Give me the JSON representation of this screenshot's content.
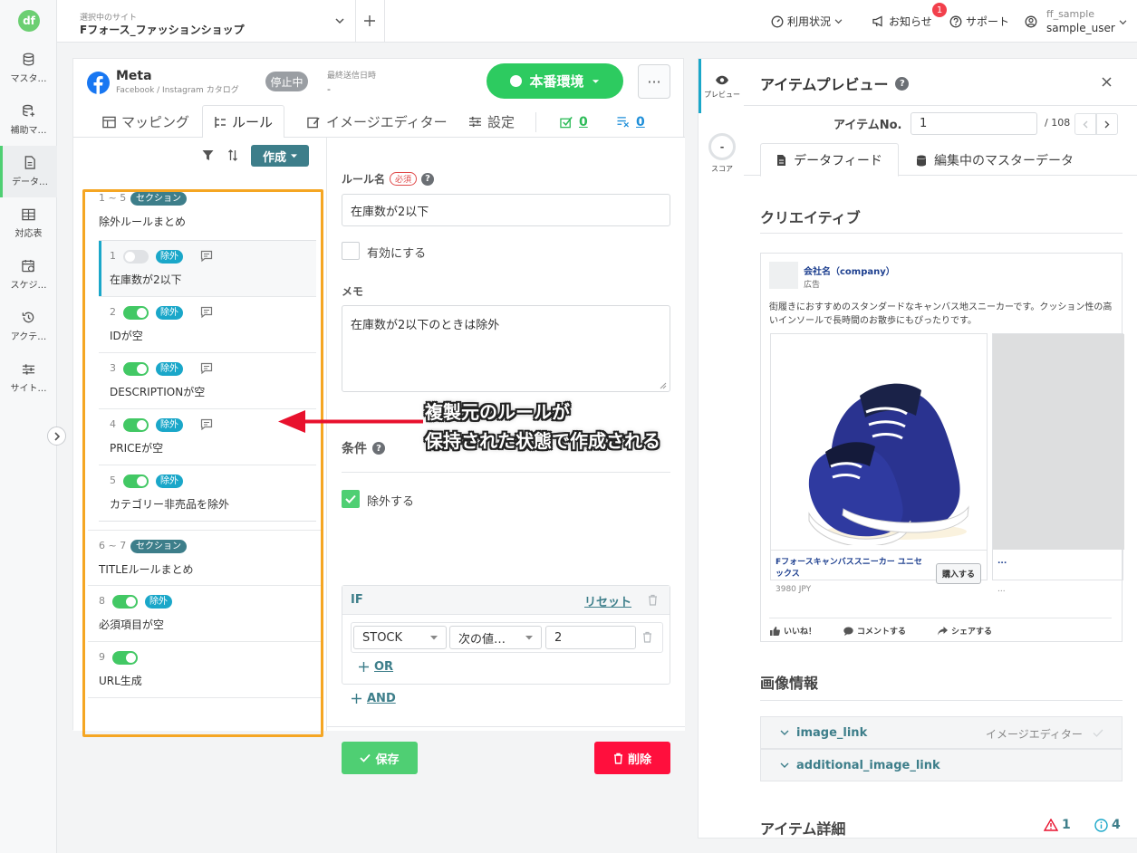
{
  "nav": {
    "items": [
      {
        "label": "マスタ…",
        "icon": "database-icon"
      },
      {
        "label": "補助マ…",
        "icon": "database-plus-icon"
      },
      {
        "label": "データ…",
        "icon": "document-icon"
      },
      {
        "label": "対応表",
        "icon": "table-icon"
      },
      {
        "label": "スケジ…",
        "icon": "schedule-icon"
      },
      {
        "label": "アクテ…",
        "icon": "history-icon"
      },
      {
        "label": "サイト…",
        "icon": "sliders-icon"
      }
    ]
  },
  "topbar": {
    "site_sub": "選択中のサイト",
    "site_name": "Fフォース_ファッションショップ",
    "usage": "利用状況",
    "news": "お知らせ",
    "news_count": "1",
    "support": "サポート",
    "user_id": "ff_sample",
    "user_name": "sample_user"
  },
  "channel": {
    "name": "Meta",
    "sub": "Facebook / Instagram カタログ",
    "status": "停止中",
    "last_sent_label": "最終送信日時",
    "last_sent_value": "-",
    "env_label": "本番環境",
    "more": "···"
  },
  "tabs": {
    "mapping": "マッピング",
    "rules": "ルール",
    "image_editor": "イメージエディター",
    "settings": "設定",
    "count_ok": "0",
    "count_ng": "0"
  },
  "list": {
    "create": "作成",
    "section1": {
      "range": "1 ~ 5",
      "tag": "セクション",
      "name": "除外ルールまとめ"
    },
    "rules_g1": [
      {
        "num": "1",
        "tag": "除外",
        "name": "在庫数が2以下"
      },
      {
        "num": "2",
        "tag": "除外",
        "name": "IDが空"
      },
      {
        "num": "3",
        "tag": "除外",
        "name": "DESCRIPTIONが空"
      },
      {
        "num": "4",
        "tag": "除外",
        "name": "PRICEが空"
      },
      {
        "num": "5",
        "tag": "除外",
        "name": "カテゴリー非売品を除外"
      }
    ],
    "section2": {
      "range": "6 ~ 7",
      "tag": "セクション",
      "name": "TITLEルールまとめ"
    },
    "rule8": {
      "num": "8",
      "tag": "除外",
      "name": "必須項目が空"
    },
    "rule9": {
      "num": "9",
      "name": "URL生成"
    }
  },
  "form": {
    "rule_name_label": "ルール名",
    "required": "必須",
    "rule_name_value": "在庫数が2以下",
    "enable_label": "有効にする",
    "memo_label": "メモ",
    "memo_value": "在庫数が2以下のときは除外",
    "condition_label": "条件",
    "exclude_label": "除外する",
    "if_label": "IF",
    "reset": "リセット",
    "field": "STOCK",
    "operator": "次の値…",
    "value": "2",
    "or": "OR",
    "and": "AND",
    "save": "保存",
    "delete": "削除"
  },
  "annotation": {
    "line1": "複製元のルールが",
    "line2": "保持された状態で作成される"
  },
  "rail": {
    "preview": "プレビュー",
    "score": "スコア",
    "score_value": "-"
  },
  "preview": {
    "title": "アイテムプレビュー",
    "item_no_label": "アイテムNo.",
    "item_no_value": "1",
    "item_total": "/ 108",
    "tab_feed": "データフィード",
    "tab_master": "編集中のマスターデータ",
    "creative_title": "クリエイティブ",
    "company": "会社名（company）",
    "ad": "広告",
    "ad_text": "街履きにおすすめのスタンダードなキャンバス地スニーカーです。クッション性の高いインソールで長時間のお散歩にもぴったりです。",
    "product_name": "Fフォースキャンバススニーカー ユニセックス",
    "product_price": "3980 JPY",
    "buy": "購入する",
    "dots": "...",
    "like": "いいね！",
    "comment": "コメントする",
    "share": "シェアする",
    "image_info_title": "画像情報",
    "image_link": "image_link",
    "image_editor_label": "イメージエディター",
    "additional_image_link": "additional_image_link",
    "item_detail_title": "アイテム詳細",
    "warn_count": "1",
    "info_count": "4"
  },
  "colors": {
    "accent": "#3d7e8a",
    "green": "#2dcb60",
    "red": "#ff0f3d",
    "orange": "#f5a623",
    "tag_blue": "#1aa7c9"
  }
}
